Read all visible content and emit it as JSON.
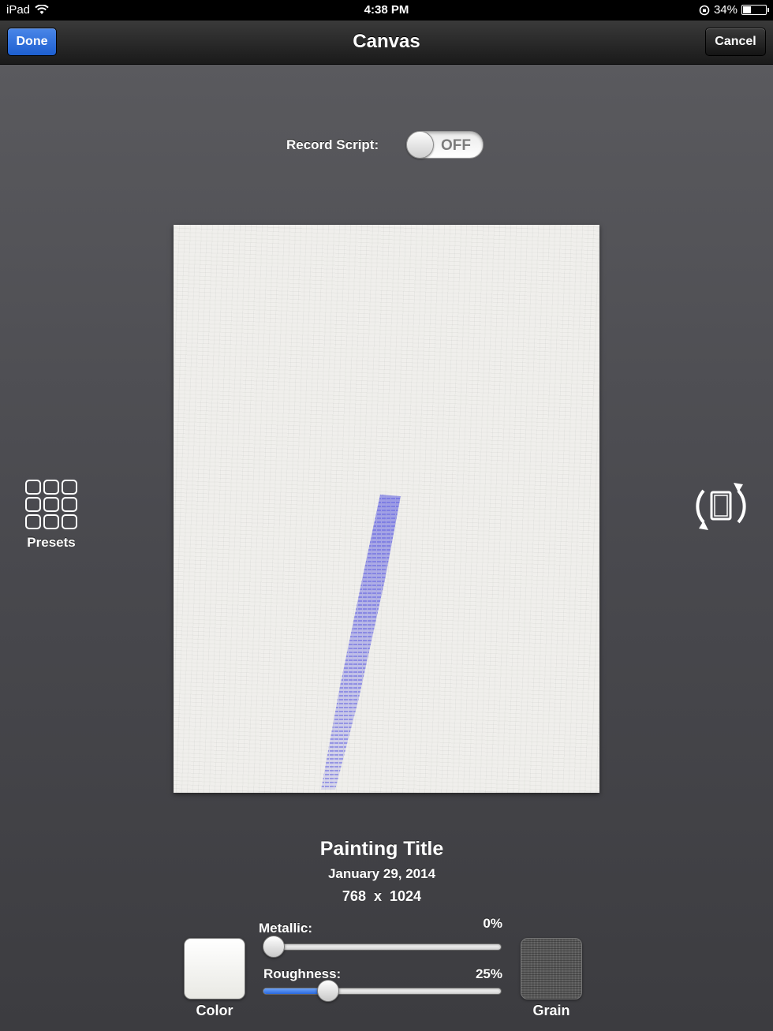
{
  "status_bar": {
    "device": "iPad",
    "time": "4:38 PM",
    "battery_percent": "34%",
    "battery_level": 0.34,
    "icons": [
      "wifi-icon",
      "rotation-lock-icon",
      "battery-icon"
    ]
  },
  "nav_bar": {
    "title": "Canvas",
    "done_label": "Done",
    "cancel_label": "Cancel"
  },
  "record_script": {
    "label": "Record Script:",
    "state": "OFF",
    "on": false
  },
  "presets": {
    "label": "Presets",
    "icon": "presets-grid-icon"
  },
  "rotate": {
    "icon": "rotate-canvas-icon"
  },
  "painting": {
    "title": "Painting Title",
    "date": "January 29, 2014",
    "width": "768",
    "times": "x",
    "height": "1024",
    "stroke_color": "#5a5ae0"
  },
  "material": {
    "metallic_label": "Metallic:",
    "metallic_value": "0%",
    "metallic_level": 0.0,
    "roughness_label": "Roughness:",
    "roughness_value": "25%",
    "roughness_level": 0.25,
    "color_label": "Color",
    "grain_label": "Grain"
  },
  "colors": {
    "accent": "#2a6ae0",
    "paper": "#f0efec"
  }
}
